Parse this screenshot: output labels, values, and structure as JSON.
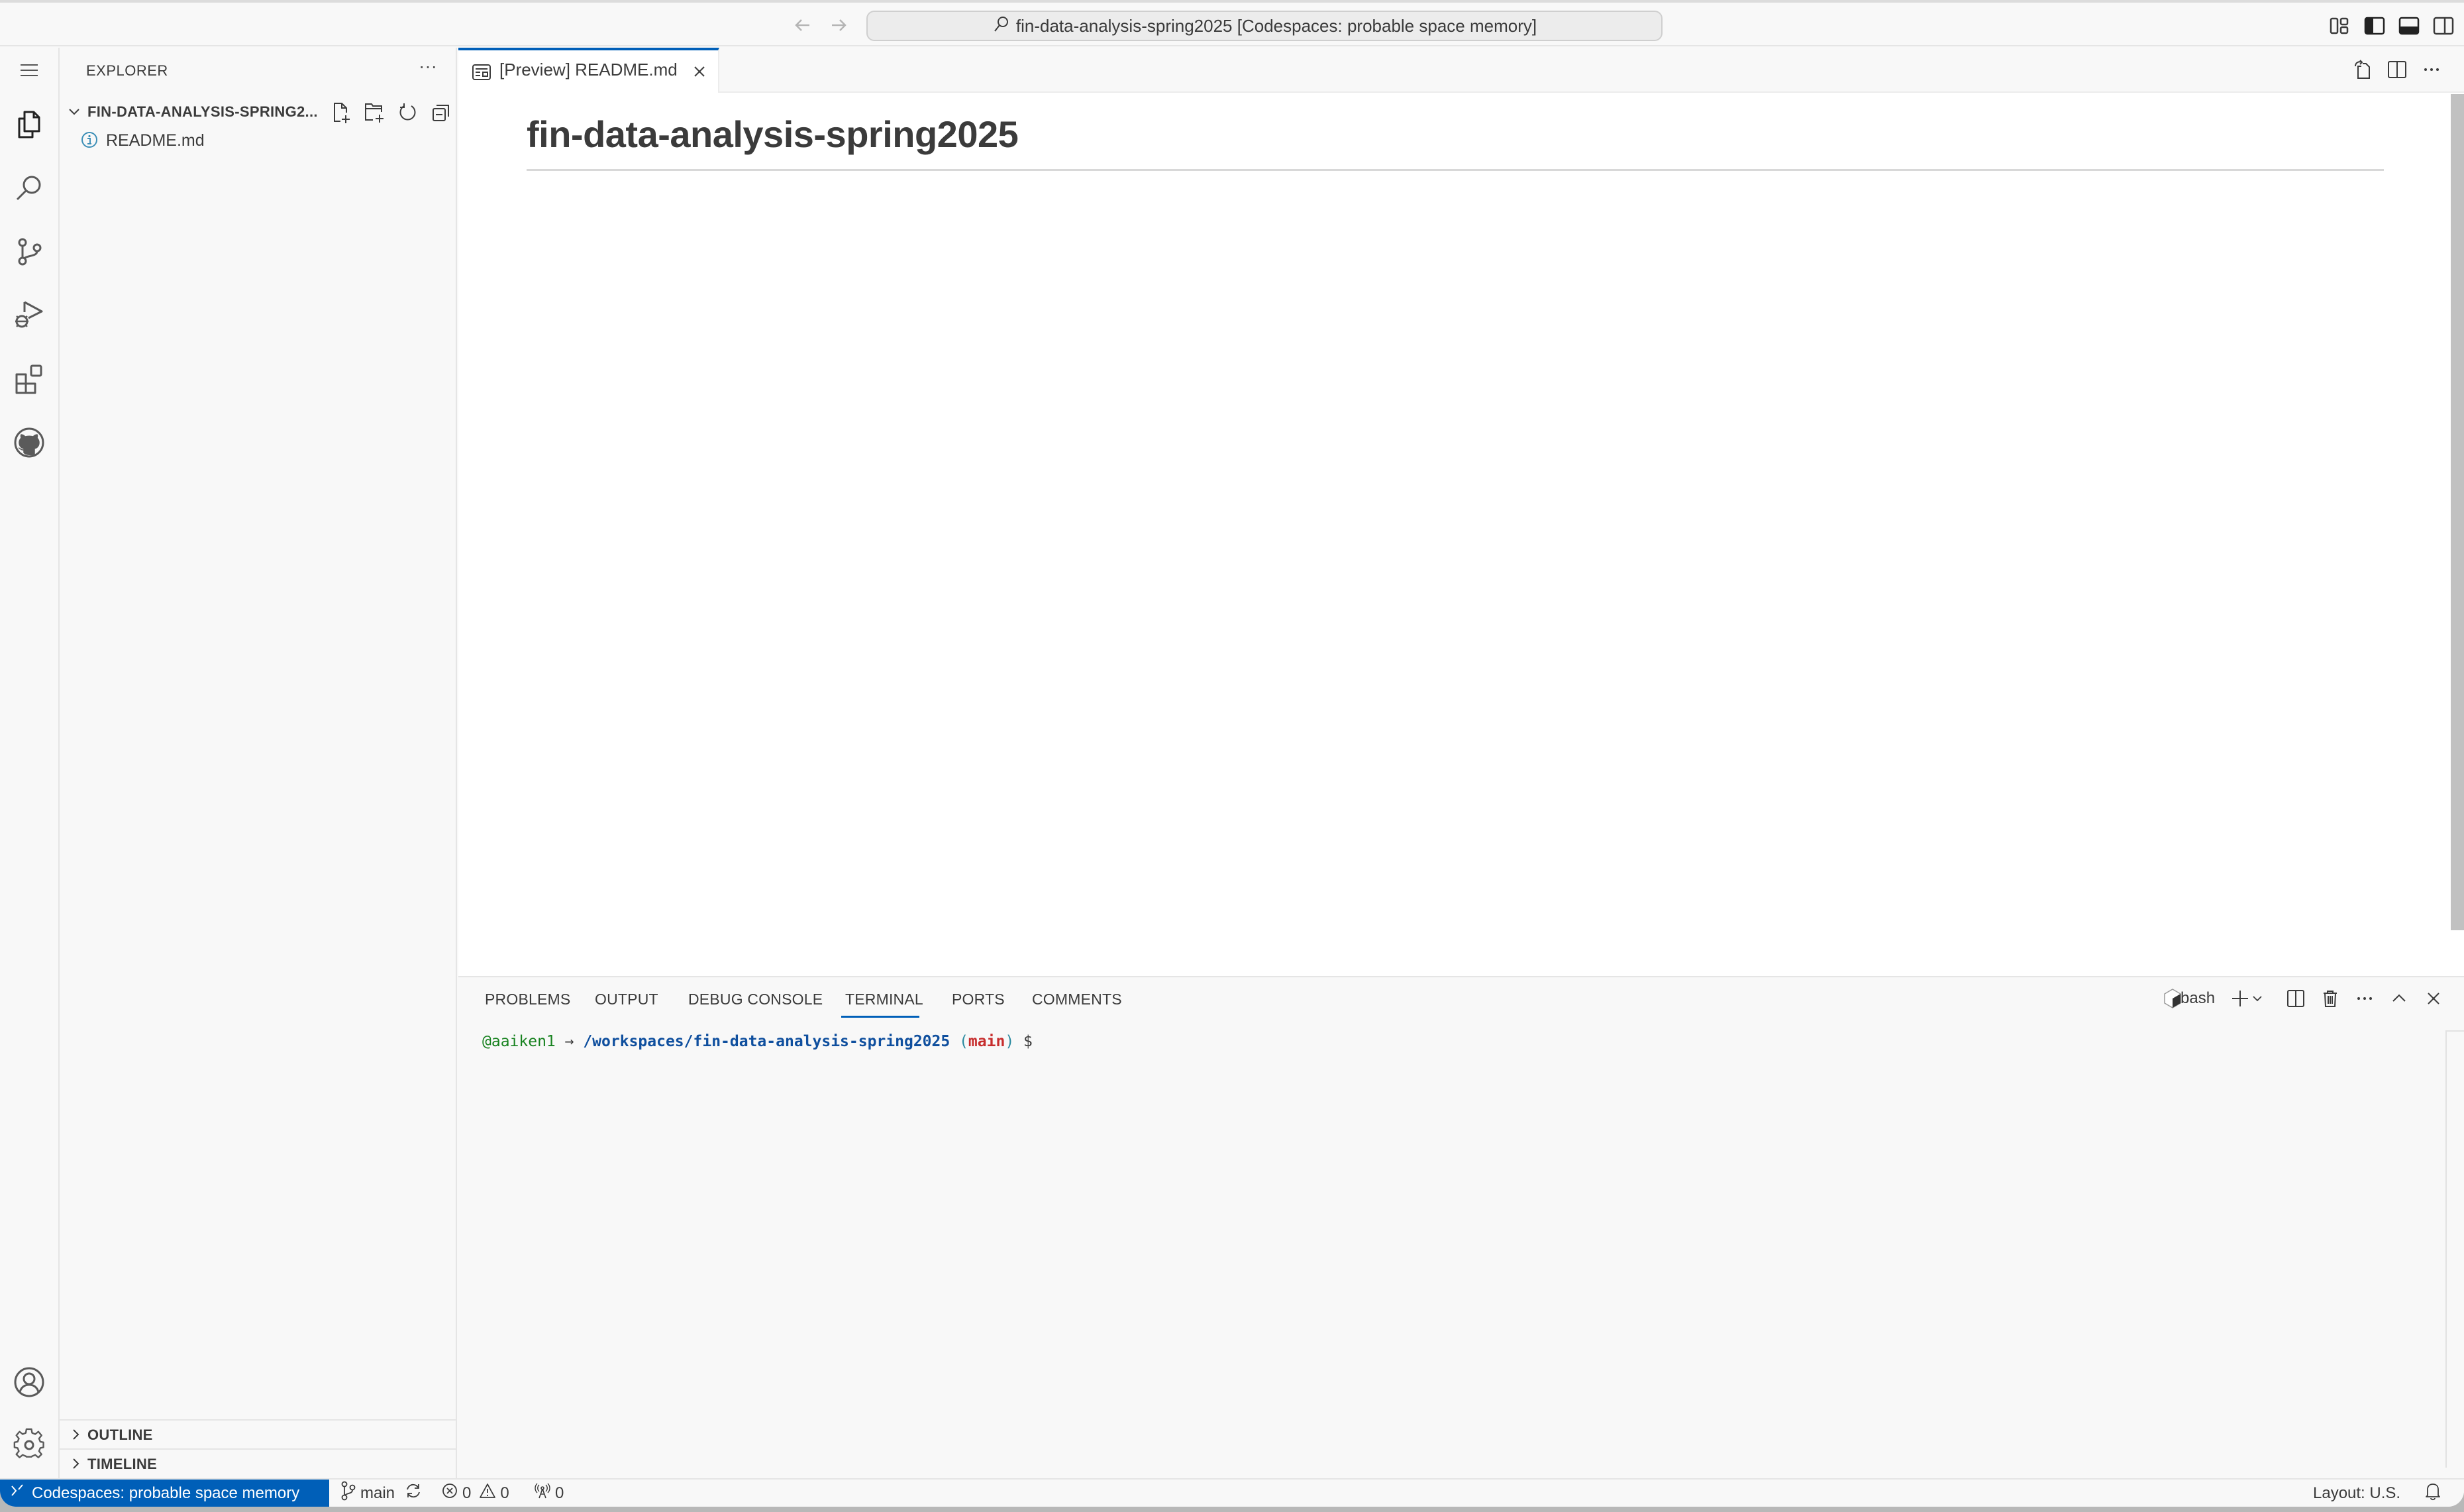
{
  "titlebar": {
    "command_center": "fin-data-analysis-spring2025 [Codespaces: probable space memory]",
    "icons": [
      "back-arrow-icon",
      "forward-arrow-icon",
      "search-icon",
      "customize-layout-icon",
      "toggle-primary-sidebar-icon",
      "toggle-panel-icon",
      "toggle-secondary-sidebar-icon"
    ]
  },
  "activity_bar": {
    "items": [
      "menu",
      "explorer",
      "search",
      "source-control",
      "run-and-debug",
      "extensions",
      "github"
    ],
    "bottom_items": [
      "accounts",
      "manage"
    ]
  },
  "sidebar": {
    "title": "EXPLORER",
    "more_label": "···",
    "folder": {
      "name": "FIN-DATA-ANALYSIS-SPRING2...",
      "actions": [
        "new-file",
        "new-folder",
        "refresh",
        "collapse-all"
      ],
      "files": [
        {
          "name": "README.md",
          "icon": "info-icon"
        }
      ]
    },
    "sections": [
      {
        "label": "OUTLINE"
      },
      {
        "label": "TIMELINE"
      }
    ]
  },
  "editor": {
    "tabs": [
      {
        "label": "[Preview] README.md",
        "active": true
      }
    ],
    "actions": [
      "open-source",
      "split-editor",
      "more-actions"
    ],
    "preview": {
      "heading": "fin-data-analysis-spring2025"
    }
  },
  "panel": {
    "tabs": [
      {
        "label": "PROBLEMS"
      },
      {
        "label": "OUTPUT"
      },
      {
        "label": "DEBUG CONSOLE"
      },
      {
        "label": "TERMINAL",
        "active": true
      },
      {
        "label": "PORTS"
      },
      {
        "label": "COMMENTS"
      }
    ],
    "terminal_shell": "bash",
    "terminal": {
      "user": "@aaiken1",
      "arrow": " → ",
      "path": "/workspaces/fin-data-analysis-spring2025",
      "paren_open": " (",
      "branch": "main",
      "paren_close": ")",
      "dollar": " $"
    }
  },
  "statusbar": {
    "remote": "Codespaces: probable space memory",
    "branch": "main",
    "errors": "0",
    "warnings": "0",
    "ports": "0",
    "layout": "Layout: U.S.",
    "colors": {
      "remote_bg": "#005fb8"
    }
  }
}
